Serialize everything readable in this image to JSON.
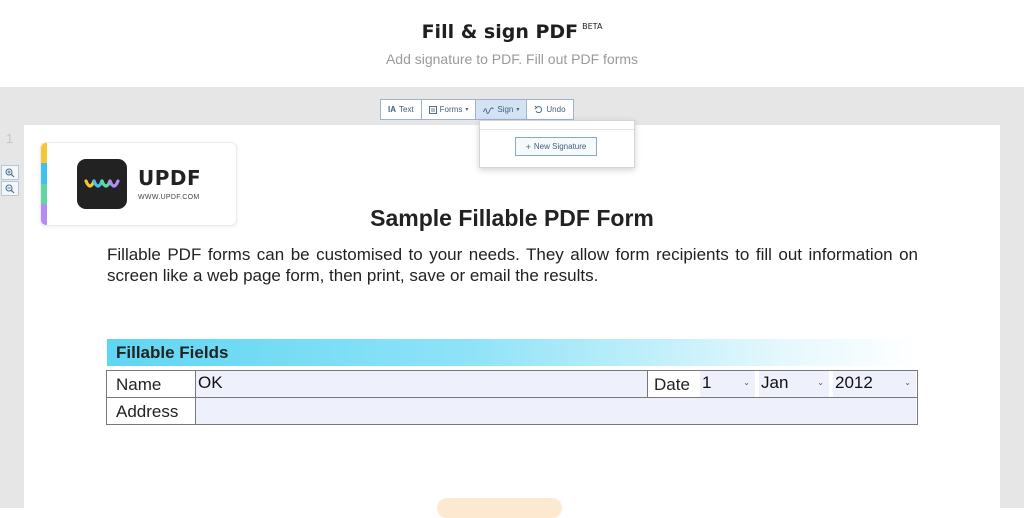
{
  "header": {
    "title": "Fill & sign PDF",
    "badge": "BETA",
    "subtitle": "Add signature to PDF. Fill out PDF forms"
  },
  "viewer": {
    "page_number": "1"
  },
  "toolbar": {
    "text_label": "Text",
    "forms_label": "Forms",
    "sign_label": "Sign",
    "undo_label": "Undo"
  },
  "sign_menu": {
    "new_signature_label": "New Signature"
  },
  "logo": {
    "name": "UPDF",
    "url": "WWW.UPDF.COM",
    "strip_colors": [
      "#f7c531",
      "#3ec1f0",
      "#5fd6a4",
      "#b48cf2"
    ]
  },
  "form": {
    "title": "Sample Fillable PDF Form",
    "description": "Fillable PDF forms can be customised to your needs. They allow form recipients to fill out information on screen like a web page form, then print, save or email the results.",
    "section_label": "Fillable Fields",
    "name_label": "Name",
    "name_value": "OK",
    "date_label": "Date",
    "day_value": "1",
    "month_value": "Jan",
    "year_value": "2012",
    "address_label": "Address",
    "address_value": ""
  },
  "colors": {
    "accent": "#40617f",
    "field_bg": "#eef0fb",
    "section_gradient_start": "#5fd6f2"
  }
}
